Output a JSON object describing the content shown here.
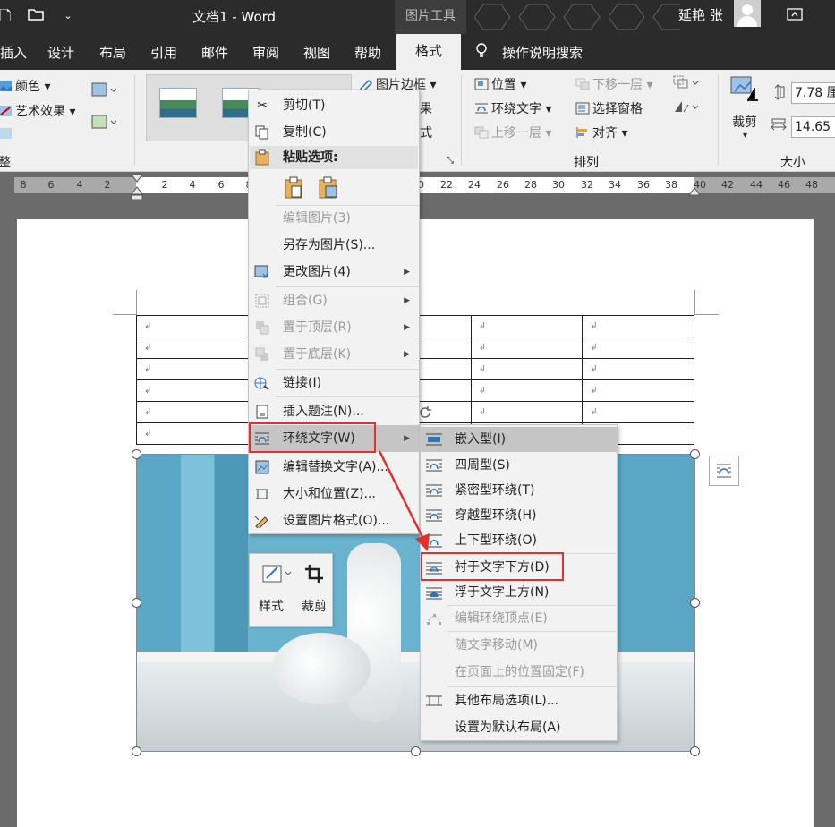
{
  "titlebar": {
    "doc_title": "文档1  -  Word",
    "context_tab": "图片工具",
    "user_name": "延艳 张"
  },
  "tabs": [
    "插入",
    "设计",
    "布局",
    "引用",
    "邮件",
    "审阅",
    "视图",
    "帮助",
    "格式",
    "操作说明搜索"
  ],
  "ribbon": {
    "color": "颜色",
    "art_effects": "艺术效果",
    "adjust_group": "整",
    "picture_border": "图片边框",
    "effects_partial": "果",
    "layout_partial": "式",
    "position": "位置",
    "wrap_text": "环绕文字",
    "bring_forward": "上移一层",
    "send_backward": "下移一层",
    "selection_pane": "选择窗格",
    "align": "对齐",
    "arrange_group": "排列",
    "crop": "裁剪",
    "height": "7.78 厘",
    "width": "14.65",
    "size_group": "大小"
  },
  "ruler": [
    "8",
    "6",
    "4",
    "2",
    "2",
    "4",
    "6",
    "8",
    "20",
    "22",
    "24",
    "26",
    "28",
    "30",
    "32",
    "34",
    "36",
    "38",
    "40",
    "42",
    "44",
    "46",
    "48"
  ],
  "table": {
    "rows": 6,
    "mark": "↲"
  },
  "context_menu": {
    "cut": "剪切(T)",
    "copy": "复制(C)",
    "paste_options": "粘贴选项:",
    "edit_picture": "编辑图片(3)",
    "save_as_picture": "另存为图片(S)...",
    "change_picture": "更改图片(4)",
    "group": "组合(G)",
    "bring_to_front": "置于顶层(R)",
    "send_to_back": "置于底层(K)",
    "link": "链接(I)",
    "insert_caption": "插入题注(N)...",
    "wrap_text": "环绕文字(W)",
    "edit_alt_text": "编辑替换文字(A)...",
    "size_position": "大小和位置(Z)...",
    "format_picture": "设置图片格式(O)..."
  },
  "submenu": {
    "inline": "嵌入型(I)",
    "square": "四周型(S)",
    "tight": "紧密型环绕(T)",
    "through": "穿越型环绕(H)",
    "top_bottom": "上下型环绕(O)",
    "behind_text": "衬于文字下方(D)",
    "in_front": "浮于文字上方(N)",
    "edit_wrap_points": "编辑环绕顶点(E)",
    "move_with_text": "随文字移动(M)",
    "fix_position": "在页面上的位置固定(F)",
    "more_layout": "其他布局选项(L)...",
    "set_default": "设置为默认布局(A)"
  },
  "mini_toolbar": {
    "style": "样式",
    "crop": "裁剪"
  },
  "colors": {
    "highlight_box": "#e0312f",
    "titlebar": "#2b2b2b",
    "menu_highlight": "#c5c5c5"
  }
}
